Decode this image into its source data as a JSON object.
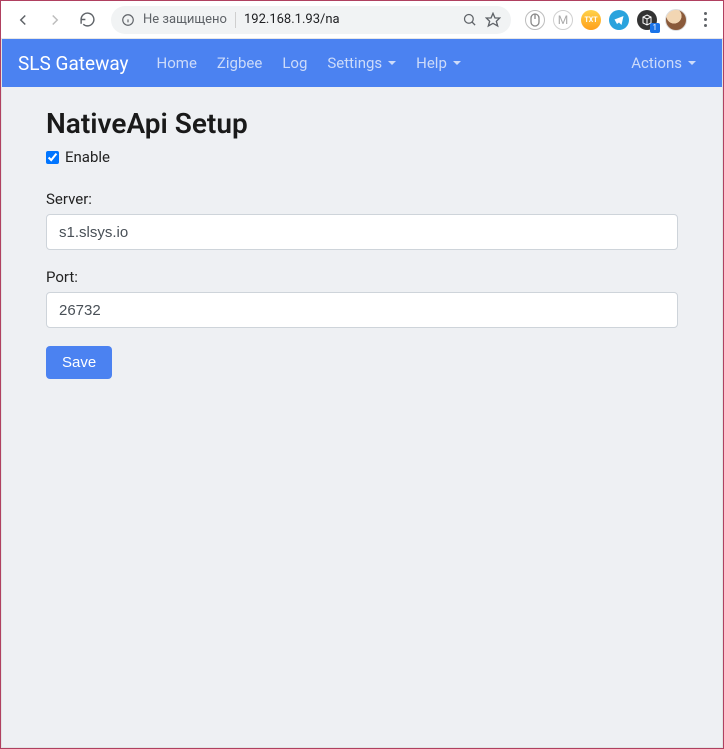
{
  "chrome": {
    "not_secure_label": "Не защищено",
    "url": "192.168.1.93/na"
  },
  "navbar": {
    "brand": "SLS Gateway",
    "items": [
      {
        "label": "Home",
        "dropdown": false
      },
      {
        "label": "Zigbee",
        "dropdown": false
      },
      {
        "label": "Log",
        "dropdown": false
      },
      {
        "label": "Settings",
        "dropdown": true
      },
      {
        "label": "Help",
        "dropdown": true
      }
    ],
    "actions": {
      "label": "Actions",
      "dropdown": true
    }
  },
  "page": {
    "title": "NativeApi Setup",
    "enable_label": "Enable",
    "enable_checked": true,
    "server_label": "Server:",
    "server_value": "s1.slsys.io",
    "port_label": "Port:",
    "port_value": "26732",
    "save_label": "Save"
  }
}
